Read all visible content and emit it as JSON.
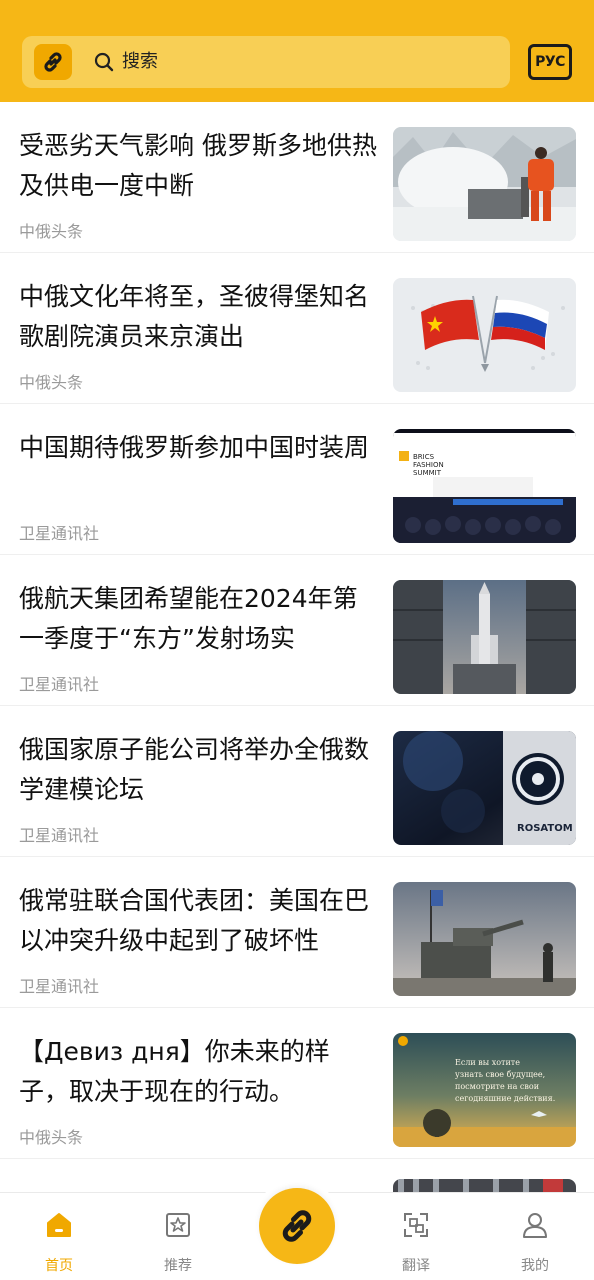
{
  "header": {
    "search_placeholder": "搜索",
    "lang_button": "РУС",
    "bg_color": "#F6B716"
  },
  "feed": {
    "items": [
      {
        "title": "受恶劣天气影响 俄罗斯多地供热及供电一度中断",
        "source": "中俄头条",
        "thumb": "snow-worker"
      },
      {
        "title": "中俄文化年将至，圣彼得堡知名歌剧院演员来京演出",
        "source": "中俄头条",
        "thumb": "flags"
      },
      {
        "title": "中国期待俄罗斯参加中国时装周",
        "source": "卫星通讯社",
        "thumb": "fashion-summit"
      },
      {
        "title": "俄航天集团希望能在2024年第一季度于“东方”发射场实",
        "source": "卫星通讯社",
        "thumb": "rocket"
      },
      {
        "title": "俄国家原子能公司将举办全俄数学建模论坛",
        "source": "卫星通讯社",
        "thumb": "rosatom"
      },
      {
        "title": "俄常驻联合国代表团：美国在巴以冲突升级中起到了破坏性",
        "source": "卫星通讯社",
        "thumb": "military"
      },
      {
        "title": "【Девиз дня】你未来的样子，取决于现在的行动。",
        "source": "中俄头条",
        "thumb": "motto"
      }
    ],
    "thumb_texts": {
      "rosatom": "ROSATOM",
      "motto_lines": [
        "Если вы хотите",
        "узнать свое будущее,",
        "посмотрите на свои",
        "сегодняшние действия."
      ],
      "summit_lines": [
        "BRICS",
        "FASHION",
        "SUMMIT"
      ]
    }
  },
  "bottom_nav": {
    "items": [
      {
        "label": "首页",
        "icon": "home-icon",
        "active": true
      },
      {
        "label": "推荐",
        "icon": "star-bookmark-icon",
        "active": false
      },
      {
        "label": "翻译",
        "icon": "translate-icon",
        "active": false
      },
      {
        "label": "我的",
        "icon": "profile-icon",
        "active": false
      }
    ],
    "center_icon": "link-icon",
    "accent": "#F0A800"
  }
}
